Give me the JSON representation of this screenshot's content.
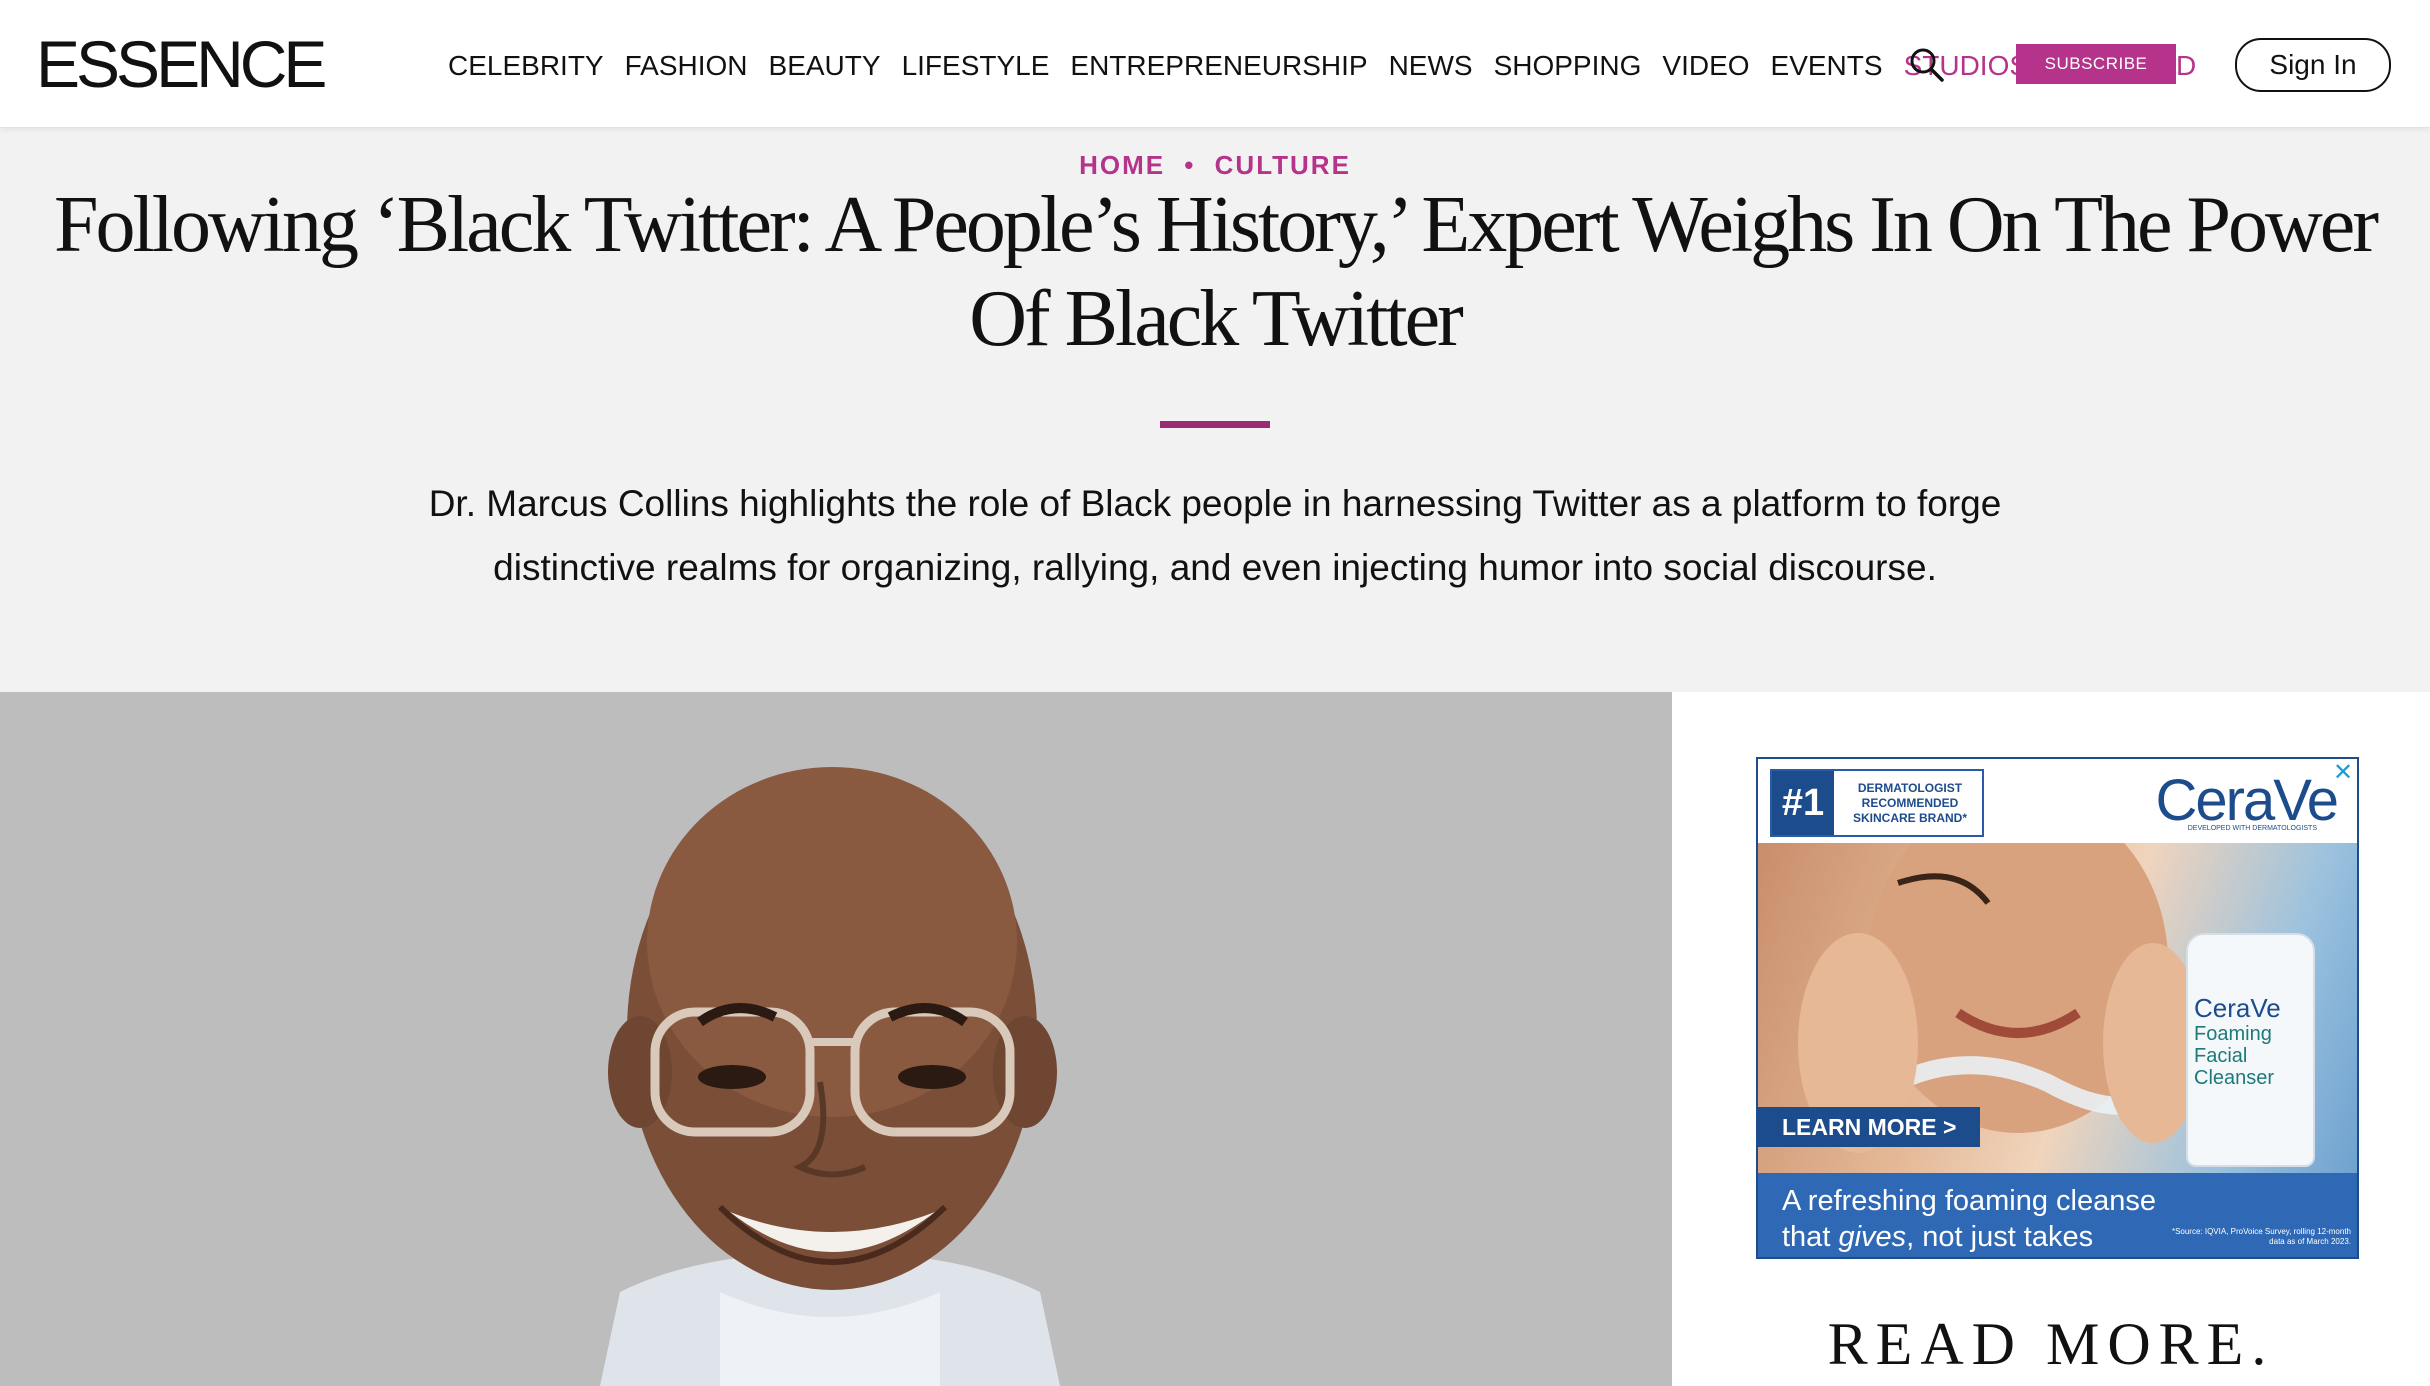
{
  "header": {
    "logo": "ESSENCE",
    "nav": [
      {
        "label": "CELEBRITY"
      },
      {
        "label": "FASHION"
      },
      {
        "label": "BEAUTY"
      },
      {
        "label": "LIFESTYLE"
      },
      {
        "label": "ENTREPRENEURSHIP"
      },
      {
        "label": "NEWS"
      },
      {
        "label": "SHOPPING"
      },
      {
        "label": "VIDEO"
      },
      {
        "label": "EVENTS"
      },
      {
        "label": "STUDIOS"
      }
    ],
    "nav_trailing": "D",
    "search_icon": "search-icon",
    "subscribe_label": "SUBSCRIBE",
    "sign_in_label": "Sign In",
    "accent_color": "#b5338a"
  },
  "article": {
    "breadcrumb": [
      "HOME",
      "CULTURE"
    ],
    "breadcrumb_sep": "•",
    "title": "Following ‘Black Twitter: A People’s History,’ Expert Weighs In On The Power Of Black Twitter",
    "dek": "Dr. Marcus Collins highlights the role of Black people in harnessing Twitter as a platform to forge distinctive realms for organizing, rallying, and even injecting humor into social discourse."
  },
  "ad": {
    "badge_number": "#1",
    "badge_text": "DERMATOLOGIST RECOMMENDED SKINCARE BRAND*",
    "brand": "CeraVe",
    "brand_sub": "DEVELOPED WITH DERMATOLOGISTS",
    "product_brand": "CeraVe",
    "product_name": "Foaming Facial Cleanser",
    "cta": "LEARN MORE >",
    "tagline_line1": "A refreshing foaming cleanse",
    "tagline_line2_pre": "that ",
    "tagline_line2_em": "gives",
    "tagline_line2_post": ", not just takes",
    "fine_print": "*Source: IQVIA, ProVoice Survey, rolling 12-month data as of March 2023.",
    "close_icon": "close-x-icon"
  },
  "sidebar": {
    "read_more": "READ MORE."
  }
}
